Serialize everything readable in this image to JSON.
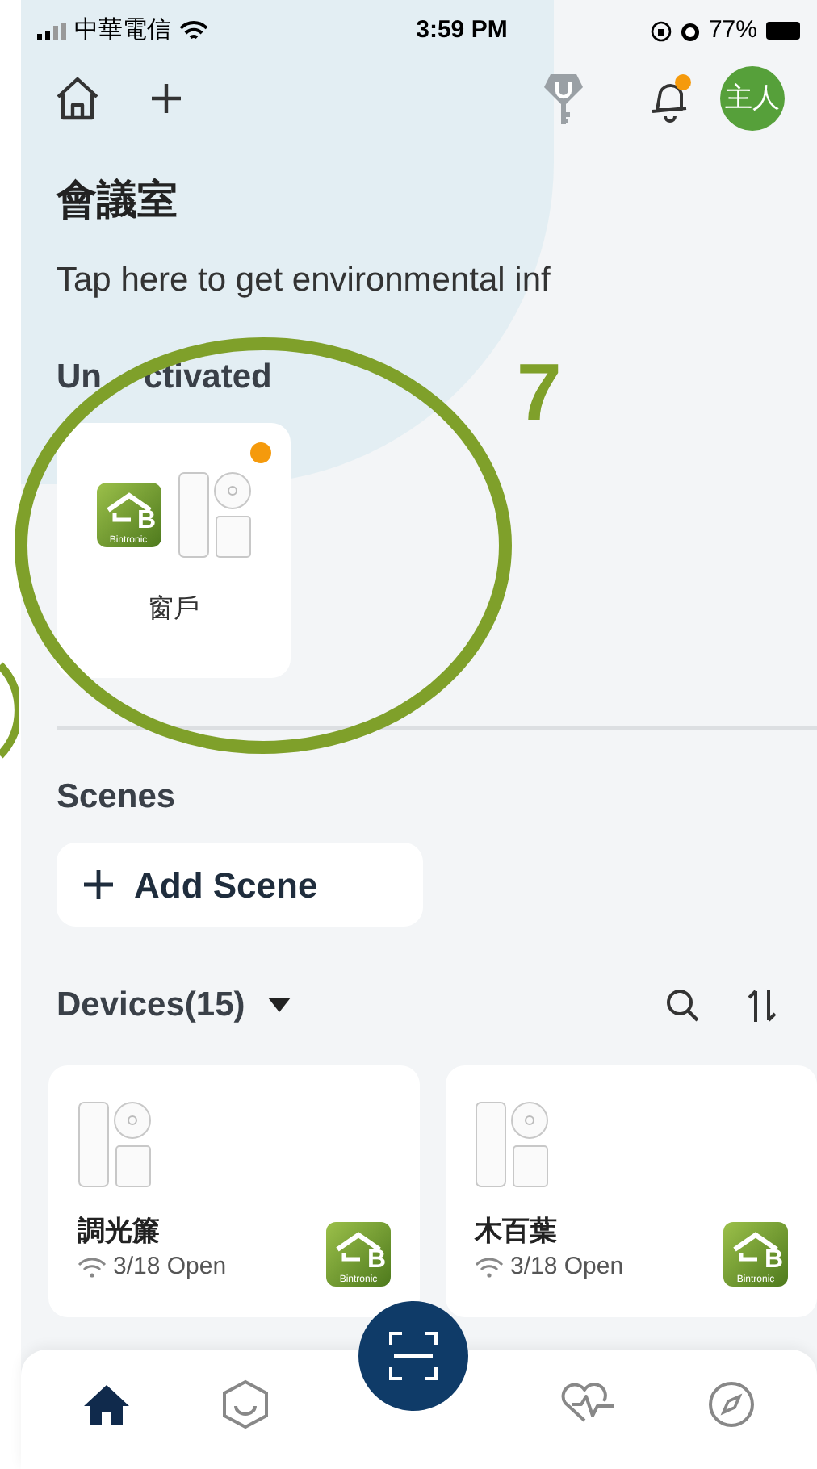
{
  "status_bar": {
    "carrier": "中華電信",
    "time": "3:59 PM",
    "battery": "77%"
  },
  "header": {
    "avatar": "主人",
    "notification_dot": true
  },
  "room": {
    "title": "會議室",
    "environment_prompt": "Tap here to get environmental inf"
  },
  "unactivated": {
    "heading_parts": [
      "Un",
      "ctivated"
    ],
    "devices": [
      {
        "name": "窗戶",
        "new": true,
        "logo": {
          "letter": "B",
          "brand": "Bintronic"
        }
      }
    ]
  },
  "scenes": {
    "heading": "Scenes",
    "add_button": "Add Scene"
  },
  "devices": {
    "heading": "Devices(15)",
    "items": [
      {
        "name": "調光簾",
        "status": "3/18 Open",
        "logo": {
          "letter": "B",
          "brand": "Bintronic"
        }
      },
      {
        "name": "木百葉",
        "status": "3/18 Open",
        "logo": {
          "letter": "B",
          "brand": "Bintronic"
        }
      }
    ]
  },
  "tab_bar": {
    "items": [
      {
        "kind": "home",
        "selected": true
      },
      {
        "kind": "hexagon",
        "selected": false
      },
      {
        "kind": "scan",
        "selected": false
      },
      {
        "kind": "health",
        "selected": false
      },
      {
        "kind": "compass",
        "selected": false
      }
    ]
  },
  "annotation": {
    "number": "7"
  }
}
